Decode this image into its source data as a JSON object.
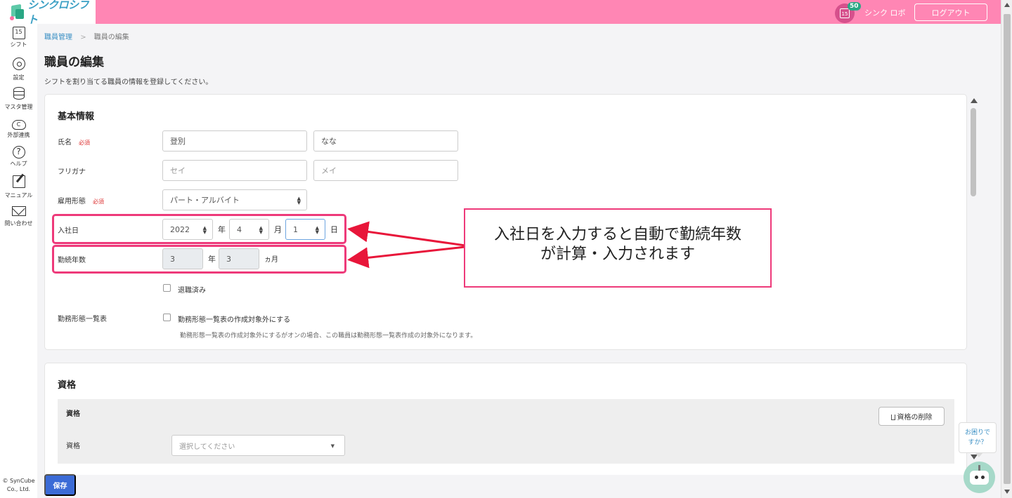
{
  "header": {
    "logo_text": "シンクロシフト",
    "calendar_day": "15",
    "notification_count": "50",
    "user_name": "シンク ロボ",
    "logout_label": "ログアウト"
  },
  "sidebar": {
    "items": [
      {
        "label": "シフト",
        "icon": "calendar-icon",
        "icon_text": "15"
      },
      {
        "label": "設定",
        "icon": "gear-icon"
      },
      {
        "label": "マスタ管理",
        "icon": "database-icon"
      },
      {
        "label": "外部連携",
        "icon": "cloud-icon"
      },
      {
        "label": "ヘルプ",
        "icon": "help-icon",
        "icon_text": "?"
      },
      {
        "label": "マニュアル",
        "icon": "edit-icon"
      },
      {
        "label": "問い合わせ",
        "icon": "mail-icon"
      }
    ],
    "copyright_line1": "© SynCube",
    "copyright_line2": "Co., Ltd."
  },
  "breadcrumb": {
    "parent": "職員管理",
    "separator": ">",
    "current": "職員の編集"
  },
  "page": {
    "title": "職員の編集",
    "description": "シフトを割り当てる職員の情報を登録してください。"
  },
  "basic_info": {
    "title": "基本情報",
    "required_label": "必須",
    "name": {
      "label": "氏名",
      "last": "登別",
      "first": "なな"
    },
    "furigana": {
      "label": "フリガナ",
      "last_placeholder": "セイ",
      "first_placeholder": "メイ"
    },
    "employment": {
      "label": "雇用形態",
      "value": "パート・アルバイト"
    },
    "hire_date": {
      "label": "入社日",
      "year": "2022",
      "year_unit": "年",
      "month": "4",
      "month_unit": "月",
      "day": "1",
      "day_unit": "日"
    },
    "tenure": {
      "label": "勤続年数",
      "years": "3",
      "years_unit": "年",
      "months": "3",
      "months_unit": "ヵ月"
    },
    "retired_label": "退職済み",
    "work_table": {
      "label": "勤務形態一覧表",
      "checkbox_label": "勤務形態一覧表の作成対象外にする",
      "note": "勤務形態一覧表の作成対象外にするがオンの場合、この職員は勤務形態一覧表作成の対象外になります。"
    }
  },
  "callout": {
    "line1": "入社日を入力すると自動で勤続年数",
    "line2": "が計算・入力されます"
  },
  "qualifications": {
    "title": "資格",
    "sub_title": "資格",
    "delete_label": "資格の削除",
    "field_label": "資格",
    "select_placeholder": "選択してください"
  },
  "save_label": "保存",
  "help_bubble": {
    "line1": "お困りで",
    "line2": "すか？"
  },
  "colors": {
    "header": "#ff86b4",
    "accent": "#ee3a7a",
    "primary": "#3b6bd6",
    "link": "#3a8fc4"
  }
}
